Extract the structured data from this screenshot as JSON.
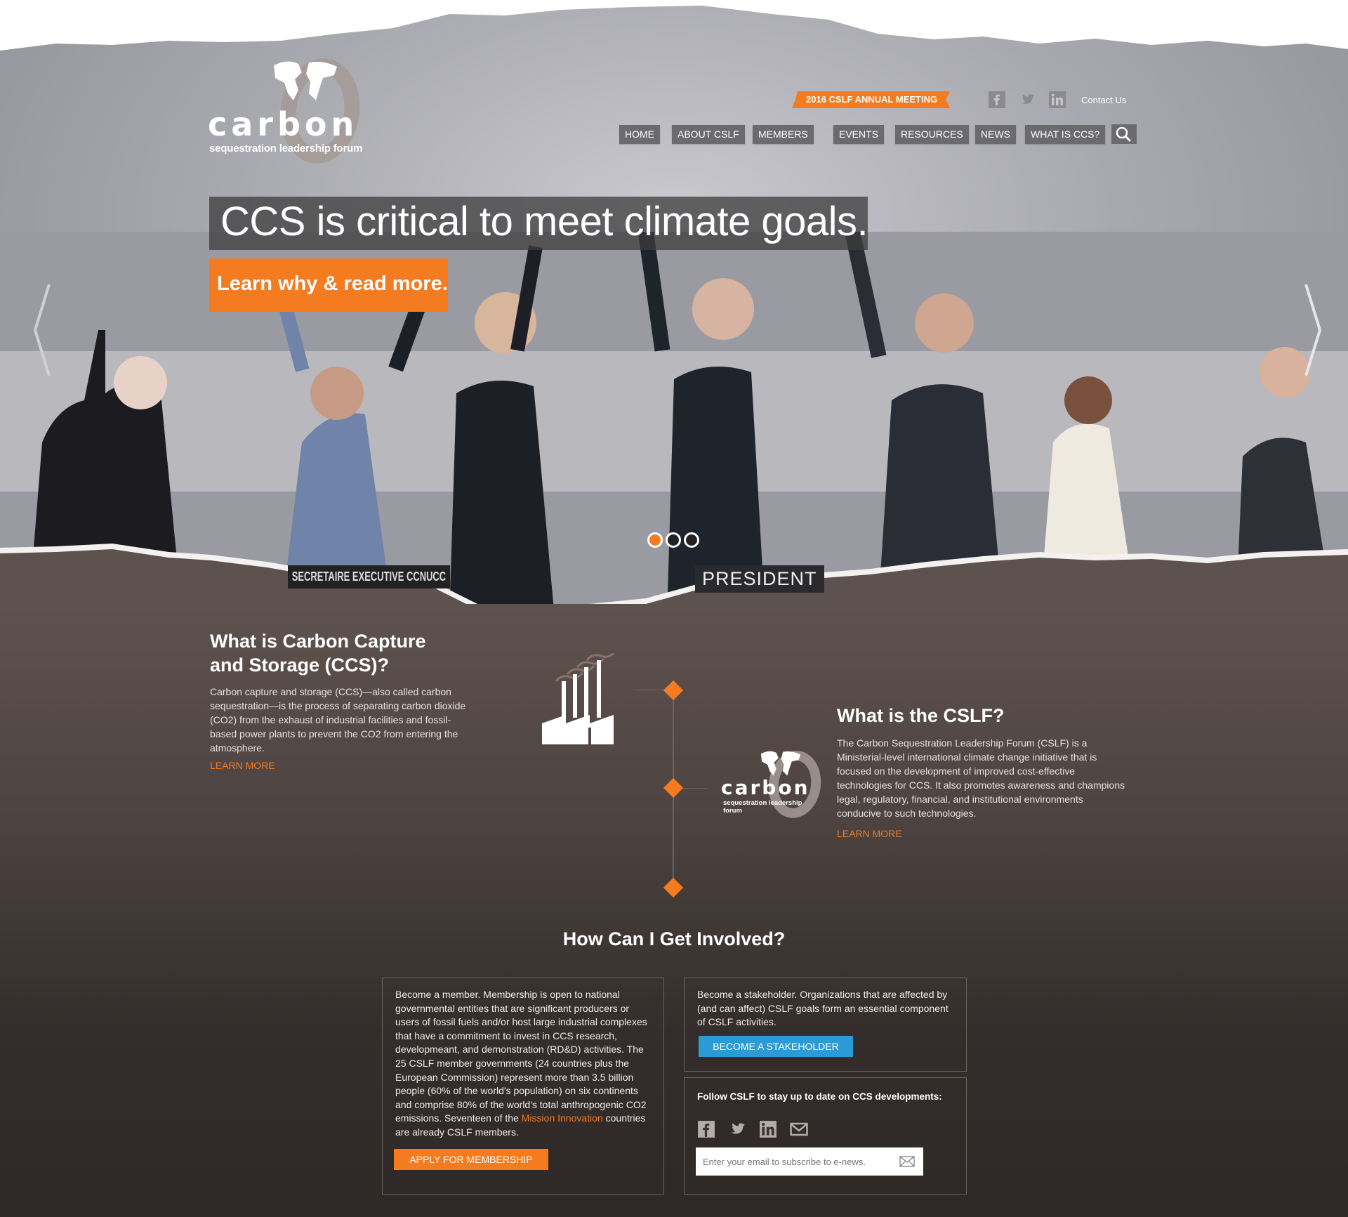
{
  "header": {
    "logo_word": "carbon",
    "logo_sub": "sequestration leadership forum",
    "annual_meeting": "2016 CSLF ANNUAL MEETING",
    "social": [
      "facebook-icon",
      "twitter-icon",
      "linkedin-icon"
    ],
    "contact": "Contact Us",
    "nav": [
      {
        "label": "HOME"
      },
      {
        "label": "ABOUT CSLF"
      },
      {
        "label": "MEMBERS"
      },
      {
        "label": "EVENTS"
      },
      {
        "label": "RESOURCES"
      },
      {
        "label": "NEWS"
      },
      {
        "label": "WHAT IS CCS?"
      }
    ]
  },
  "hero": {
    "headline": "CCS is critical to meet climate goals.",
    "cta": "Learn why & read more.",
    "slides": 3,
    "active_slide": 1,
    "nameplate_left": "SECRETAIRE EXECUTIVE CCNUCC",
    "nameplate_right": "PRESIDENT"
  },
  "ccs": {
    "title": "What is Carbon Capture and Storage (CCS)?",
    "body": "Carbon capture and storage (CCS)—also called carbon sequestration—is the process of separating carbon dioxide (CO2) from the exhaust of industrial facilities and fossil-based power plants to prevent the CO2 from entering the atmosphere.",
    "link": "LEARN MORE"
  },
  "cslf": {
    "title": "What is the CSLF?",
    "body": "The Carbon Sequestration Leadership Forum (CSLF) is a Ministerial-level international climate change initiative that is focused on the development of improved cost-effective technologies for CCS. It also promotes awareness and champions legal, regulatory, financial, and institutional environments conducive to such technologies.",
    "link": "LEARN MORE"
  },
  "involved": {
    "title": "How Can I Get Involved?",
    "member_text_a": "Become a member. Membership is open to national governmental entities that are significant producers or users of fossil fuels and/or host large industrial complexes that have a commitment to invest in CCS research, developmeant, and demonstration (RD&D) activities. The 25 CSLF member governments (24 countries plus the European Commission) represent more than 3.5 billion people (60% of the world's population) on six continents and comprise 80% of the world's total anthropogenic CO2 emissions. Seventeen of the ",
    "member_link": "Mission Innovation",
    "member_text_b": " countries are already CSLF members.",
    "apply_button": "APPLY FOR MEMBERSHIP",
    "stake_text": "Become a stakeholder. Organizations that are affected by (and can affect) CSLF goals form an essential component of CSLF activities.",
    "stake_button": "BECOME A STAKEHOLDER",
    "follow_label": "Follow CSLF to stay up to date on CCS developments:",
    "follow_social": [
      "facebook-icon",
      "twitter-icon",
      "linkedin-icon",
      "email-icon"
    ],
    "email_placeholder": "Enter your email to subscribe to e-news."
  },
  "colors": {
    "accent": "#f47b20",
    "blue": "#2a9bd6",
    "nav": "#6a6a6f"
  }
}
